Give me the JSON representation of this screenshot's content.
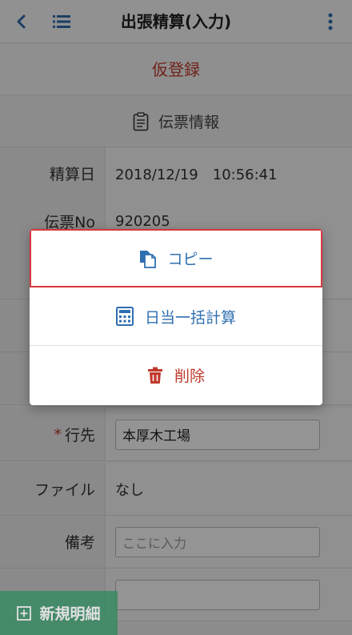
{
  "header": {
    "title": "出張精算(入力)"
  },
  "status": {
    "text": "仮登録"
  },
  "section": {
    "title": "伝票情報"
  },
  "fields": [
    {
      "label": "精算日",
      "value": "2018/12/19　10:56:41"
    },
    {
      "label": "伝票No",
      "value": "920205"
    },
    {
      "label": "",
      "value": ""
    },
    {
      "label": "",
      "value": ""
    },
    {
      "label": "",
      "value": ""
    },
    {
      "label": "行先",
      "value": "本厚木工場",
      "required": true
    },
    {
      "label": "ファイル",
      "value": "なし"
    },
    {
      "label": "備考",
      "placeholder": "ここに入力"
    }
  ],
  "menu": {
    "items": [
      {
        "label": "コピー",
        "icon": "copy-icon",
        "color": "#2f6fb0"
      },
      {
        "label": "日当一括計算",
        "icon": "calculator-icon",
        "color": "#2f6fb0"
      },
      {
        "label": "削除",
        "icon": "trash-icon",
        "color": "#c0392b"
      }
    ]
  },
  "fab": {
    "label": "新規明細",
    "icon": "plus-square-icon"
  }
}
